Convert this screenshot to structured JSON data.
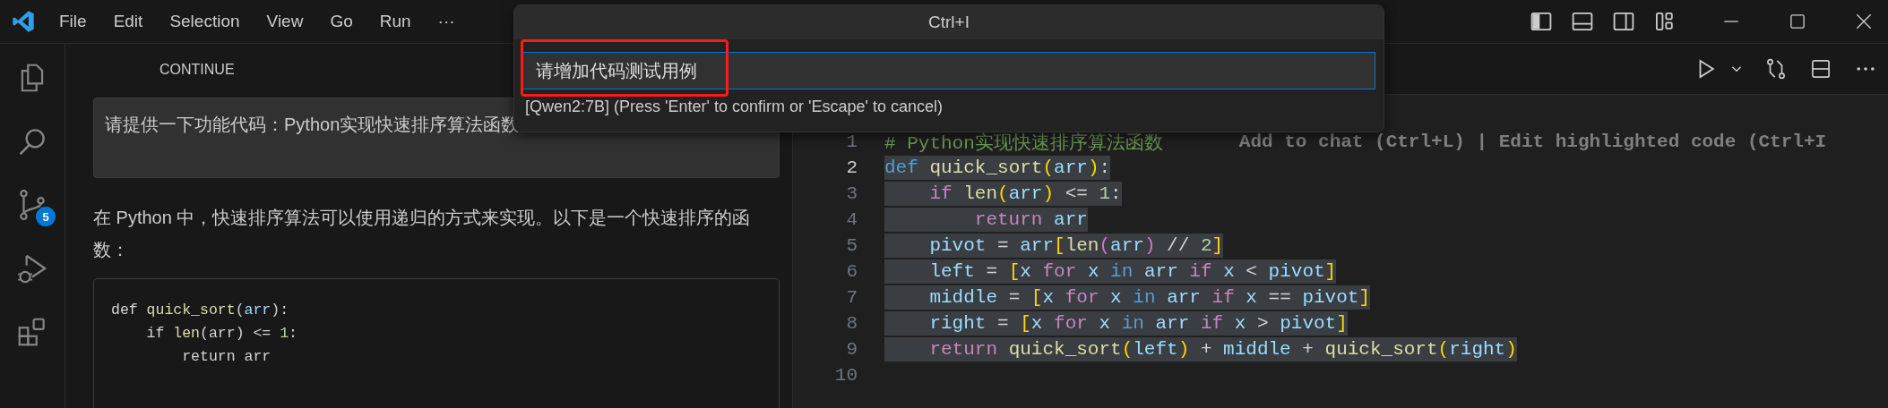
{
  "menu": [
    "File",
    "Edit",
    "Selection",
    "View",
    "Go",
    "Run",
    "···"
  ],
  "activity_bar": [
    {
      "kind": "files"
    },
    {
      "kind": "search"
    },
    {
      "kind": "source-control",
      "badge": "5"
    },
    {
      "kind": "debug"
    },
    {
      "kind": "extensions"
    }
  ],
  "panel": {
    "title": "CONTINUE",
    "user_message": "请提供一下功能代码：Python实现快速排序算法函数",
    "response": "在 Python 中，快速排序算法可以使用递归的方式来实现。以下是一个快速排序的函数：",
    "code": [
      [
        {
          "kind": "plain",
          "text": "def "
        },
        {
          "kind": "func",
          "text": "quick_sort"
        },
        {
          "kind": "plain",
          "text": "("
        },
        {
          "kind": "var",
          "text": "arr"
        },
        {
          "kind": "plain",
          "text": "):"
        }
      ],
      [
        {
          "kind": "plain",
          "text": "    if "
        },
        {
          "kind": "func",
          "text": "len"
        },
        {
          "kind": "plain",
          "text": "(arr) <= "
        },
        {
          "kind": "num",
          "text": "1"
        },
        {
          "kind": "plain",
          "text": ":"
        }
      ],
      [
        {
          "kind": "plain",
          "text": "        return arr"
        }
      ]
    ]
  },
  "command_palette": {
    "title": "Ctrl+I",
    "value": "请增加代码测试用例",
    "hint": "[Qwen2:7B] (Press 'Enter' to confirm or 'Escape' to cancel)"
  },
  "editor": {
    "inline_hint": "Add to chat (Ctrl+L) | Edit highlighted code (Ctrl+I",
    "lines": [
      {
        "number": "1",
        "current": false,
        "selected": false,
        "tokens": [
          {
            "kind": "comment",
            "text": "# Python实现快速排序算法函数"
          }
        ]
      },
      {
        "number": "2",
        "current": true,
        "selected": true,
        "tokens": [
          {
            "kind": "keyword",
            "text": "def "
          },
          {
            "kind": "func",
            "text": "quick_sort"
          },
          {
            "kind": "bracket",
            "text": "("
          },
          {
            "kind": "var",
            "text": "arr"
          },
          {
            "kind": "bracket",
            "text": ")"
          },
          {
            "kind": "plain",
            "text": ":"
          }
        ]
      },
      {
        "number": "3",
        "current": false,
        "selected": true,
        "tokens": [
          {
            "kind": "control",
            "text": "    if "
          },
          {
            "kind": "func",
            "text": "len"
          },
          {
            "kind": "bracket",
            "text": "("
          },
          {
            "kind": "var",
            "text": "arr"
          },
          {
            "kind": "bracket",
            "text": ")"
          },
          {
            "kind": "plain",
            "text": " <= "
          },
          {
            "kind": "num",
            "text": "1"
          },
          {
            "kind": "plain",
            "text": ":"
          }
        ]
      },
      {
        "number": "4",
        "current": false,
        "selected": true,
        "tokens": [
          {
            "kind": "control",
            "text": "        return "
          },
          {
            "kind": "var",
            "text": "arr"
          }
        ]
      },
      {
        "number": "5",
        "current": false,
        "selected": true,
        "tokens": [
          {
            "kind": "var",
            "text": "    pivot"
          },
          {
            "kind": "plain",
            "text": " = "
          },
          {
            "kind": "var",
            "text": "arr"
          },
          {
            "kind": "bracket",
            "text": "["
          },
          {
            "kind": "func",
            "text": "len"
          },
          {
            "kind": "bracket2",
            "text": "("
          },
          {
            "kind": "var",
            "text": "arr"
          },
          {
            "kind": "bracket2",
            "text": ")"
          },
          {
            "kind": "plain",
            "text": " // "
          },
          {
            "kind": "num",
            "text": "2"
          },
          {
            "kind": "bracket",
            "text": "]"
          }
        ]
      },
      {
        "number": "6",
        "current": false,
        "selected": true,
        "tokens": [
          {
            "kind": "var",
            "text": "    left"
          },
          {
            "kind": "plain",
            "text": " = "
          },
          {
            "kind": "bracket",
            "text": "["
          },
          {
            "kind": "var",
            "text": "x "
          },
          {
            "kind": "control",
            "text": "for "
          },
          {
            "kind": "var",
            "text": "x "
          },
          {
            "kind": "keyword",
            "text": "in "
          },
          {
            "kind": "var",
            "text": "arr "
          },
          {
            "kind": "control",
            "text": "if "
          },
          {
            "kind": "var",
            "text": "x"
          },
          {
            "kind": "plain",
            "text": " < "
          },
          {
            "kind": "var",
            "text": "pivot"
          },
          {
            "kind": "bracket",
            "text": "]"
          }
        ]
      },
      {
        "number": "7",
        "current": false,
        "selected": true,
        "tokens": [
          {
            "kind": "var",
            "text": "    middle"
          },
          {
            "kind": "plain",
            "text": " = "
          },
          {
            "kind": "bracket",
            "text": "["
          },
          {
            "kind": "var",
            "text": "x "
          },
          {
            "kind": "control",
            "text": "for "
          },
          {
            "kind": "var",
            "text": "x "
          },
          {
            "kind": "keyword",
            "text": "in "
          },
          {
            "kind": "var",
            "text": "arr "
          },
          {
            "kind": "control",
            "text": "if "
          },
          {
            "kind": "var",
            "text": "x"
          },
          {
            "kind": "plain",
            "text": " == "
          },
          {
            "kind": "var",
            "text": "pivot"
          },
          {
            "kind": "bracket",
            "text": "]"
          }
        ]
      },
      {
        "number": "8",
        "current": false,
        "selected": true,
        "tokens": [
          {
            "kind": "var",
            "text": "    right"
          },
          {
            "kind": "plain",
            "text": " = "
          },
          {
            "kind": "bracket",
            "text": "["
          },
          {
            "kind": "var",
            "text": "x "
          },
          {
            "kind": "control",
            "text": "for "
          },
          {
            "kind": "var",
            "text": "x "
          },
          {
            "kind": "keyword",
            "text": "in "
          },
          {
            "kind": "var",
            "text": "arr "
          },
          {
            "kind": "control",
            "text": "if "
          },
          {
            "kind": "var",
            "text": "x"
          },
          {
            "kind": "plain",
            "text": " > "
          },
          {
            "kind": "var",
            "text": "pivot"
          },
          {
            "kind": "bracket",
            "text": "]"
          }
        ]
      },
      {
        "number": "9",
        "current": false,
        "selected": true,
        "tokens": [
          {
            "kind": "control",
            "text": "    return "
          },
          {
            "kind": "func",
            "text": "quick_sort"
          },
          {
            "kind": "bracket",
            "text": "("
          },
          {
            "kind": "var",
            "text": "left"
          },
          {
            "kind": "bracket",
            "text": ")"
          },
          {
            "kind": "plain",
            "text": " + "
          },
          {
            "kind": "var",
            "text": "middle"
          },
          {
            "kind": "plain",
            "text": " + "
          },
          {
            "kind": "func",
            "text": "quick_sort"
          },
          {
            "kind": "bracket",
            "text": "("
          },
          {
            "kind": "var",
            "text": "right"
          },
          {
            "kind": "bracket",
            "text": ")"
          }
        ]
      },
      {
        "number": "10",
        "current": false
      }
    ]
  }
}
